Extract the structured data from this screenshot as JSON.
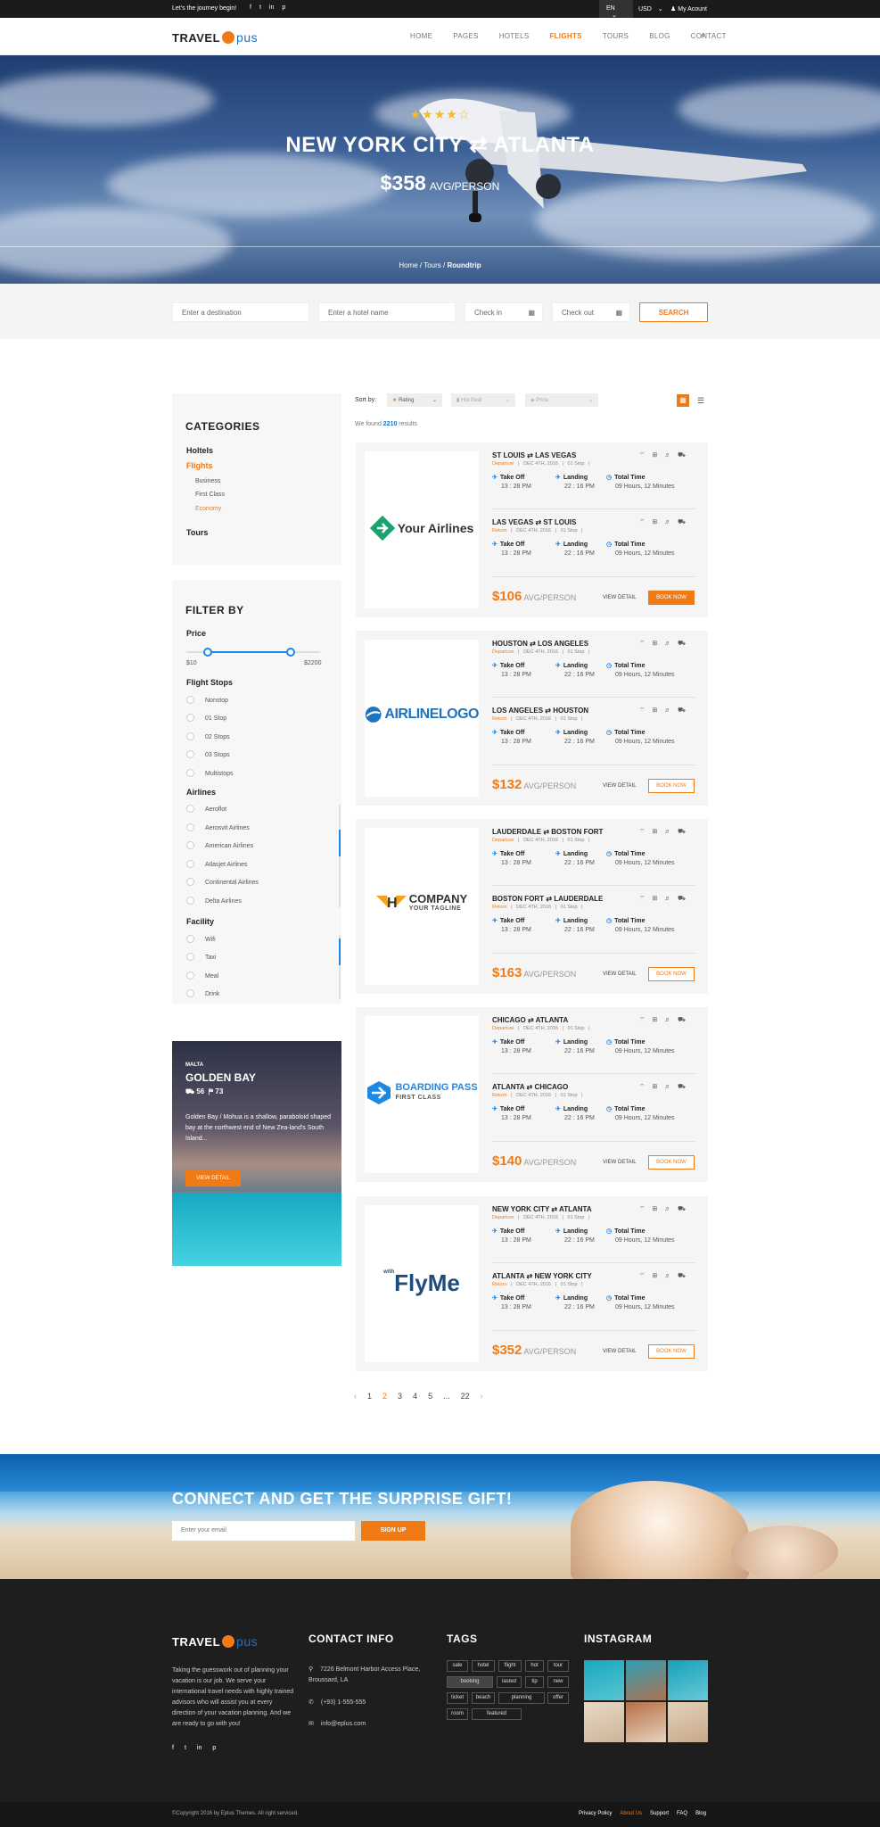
{
  "topbar": {
    "tagline": "Let's the journey begin!",
    "social": [
      "f",
      "t",
      "in",
      "p"
    ],
    "lang": "EN",
    "currency": "USD",
    "account": "My Acount"
  },
  "brand": {
    "travel": "TRAVEL",
    "opus": "pus"
  },
  "nav": {
    "items": [
      "HOME",
      "PAGES",
      "HOTELS",
      "FLIGHTS",
      "TOURS",
      "BLOG",
      "CONTACT"
    ],
    "active": "FLIGHTS"
  },
  "hero": {
    "stars": "★★★★☆",
    "from": "NEW YORK CITY",
    "arrow": "⇄",
    "to": "ATLANTA",
    "price": "$358",
    "per": "AVG/PERSON",
    "crumb": [
      "Home",
      "Tours",
      "Roundtrip"
    ]
  },
  "search": {
    "dest": "Enter a destination",
    "hotel": "Enter a hotel name",
    "checkin": "Check in",
    "checkout": "Check out",
    "button": "SEARCH"
  },
  "sort": {
    "label": "Sort by:",
    "options": [
      "Rating",
      "Hot Deal",
      "Price"
    ]
  },
  "found": {
    "pre": "We found ",
    "count": "2210",
    "post": " results"
  },
  "categories": {
    "title": "CATEGORIES",
    "items": [
      "Holtels",
      "Flights",
      "Business",
      "First Class",
      "Economy",
      "Tours"
    ]
  },
  "filter": {
    "title": "FILTER BY",
    "price": "Price",
    "pmin": "$10",
    "pmax": "$2200",
    "stops_title": "Flight Stops",
    "stops": [
      "Nonstop",
      "01 Stop",
      "02 Stops",
      "03 Stops",
      "Multistops"
    ],
    "airlines_title": "Airlines",
    "airlines": [
      "Aeroflot",
      "Aerosvit Airlines",
      "American Airlines",
      "Atlasjet Airlines",
      "Continental Airlines",
      "Delta Airlines"
    ],
    "facility_title": "Facility",
    "facility": [
      "Wifi",
      "Taxi",
      "Meal",
      "Drink"
    ]
  },
  "promo": {
    "country": "MALTA",
    "title": "GOLDEN BAY",
    "beds": "56",
    "baths": "73",
    "desc": "Golden Bay / Mohua is a shallow, paraboloid shaped bay at the northwest end of New Zea-land's South Island...",
    "button": "VIEW DETAIL"
  },
  "labels": {
    "takeoff": "Take Off",
    "landing": "Landing",
    "total": "Total Time",
    "time1": "13 : 28 PM",
    "time2": "22 : 16 PM",
    "total_v": "09 Hours, 12 Minutes",
    "departure": "Departure",
    "return": "Return",
    "date": "DEC 4TH, 2016",
    "stop": "01 Stop",
    "per": "AVG/PERSON",
    "detail": "VIEW DETAIL",
    "book": "BOOK NOW",
    "amenities": "⌔ ⊞ ♬ ⛟"
  },
  "flights": [
    {
      "logo": "Your Airlines",
      "out": [
        "ST LOUIS",
        "LAS VEGAS"
      ],
      "ret": [
        "LAS VEGAS",
        "ST LOUIS"
      ],
      "price": "$106",
      "primary": true
    },
    {
      "logo": "AIRLINELOGO",
      "out": [
        "HOUSTON",
        "LOS ANGELES"
      ],
      "ret": [
        "LOS ANGELES",
        "HOUSTON"
      ],
      "price": "$132",
      "primary": false
    },
    {
      "logo": "COMPANY",
      "logo_sub": "YOUR TAGLINE",
      "out": [
        "LAUDERDALE",
        "BOSTON FORT"
      ],
      "ret": [
        "BOSTON FORT",
        "LAUDERDALE"
      ],
      "price": "$163",
      "primary": false
    },
    {
      "logo": "BOARDING PASS",
      "logo_sub": "FIRST CLASS",
      "out": [
        "CHICAGO",
        "ATLANTA"
      ],
      "ret": [
        "ATLANTA",
        "CHICAGO"
      ],
      "price": "$140",
      "primary": false
    },
    {
      "logo": "FlyMe",
      "logo_sub": "with",
      "out": [
        "NEW YORK CITY",
        "ATLANTA"
      ],
      "ret": [
        "ATLANTA",
        "NEW YORK CITY"
      ],
      "price": "$352",
      "primary": false
    }
  ],
  "pager": [
    "‹",
    "1",
    "2",
    "3",
    "4",
    "5",
    "...",
    "22",
    "›"
  ],
  "newsletter": {
    "title": "CONNECT AND GET THE SURPRISE GIFT!",
    "placeholder": "Enter your email",
    "button": "SIGN UP"
  },
  "footer": {
    "about": "Taking the guesswork out of planning your vacation is our job. We serve your international travel needs with highly trained advisors who will assist you at every direction of your vacation planning. And we are ready to go with you!",
    "contact_title": "CONTACT INFO",
    "address": "7226 Belmont Harbor Access Place, Broussard, LA",
    "phone": "(+93) 1-555-555",
    "email": "info@eplus.com",
    "tags_title": "TAGS",
    "tags": [
      "sale",
      "hotel",
      "flight",
      "hot",
      "tour",
      "booking",
      "lasted",
      "tip",
      "new",
      "ticket",
      "beach",
      "planning",
      "offer",
      "room",
      "featured"
    ],
    "insta_title": "INSTAGRAM",
    "copyright": "Copyright 2016 by Eplus Themes. All right serviced.",
    "links": [
      "Privacy Policy",
      "About Us",
      "Support",
      "FAQ",
      "Blog"
    ]
  },
  "colors": {
    "accent": "#f07b16",
    "blue": "#1e73be",
    "dark": "#1e1e1e"
  }
}
